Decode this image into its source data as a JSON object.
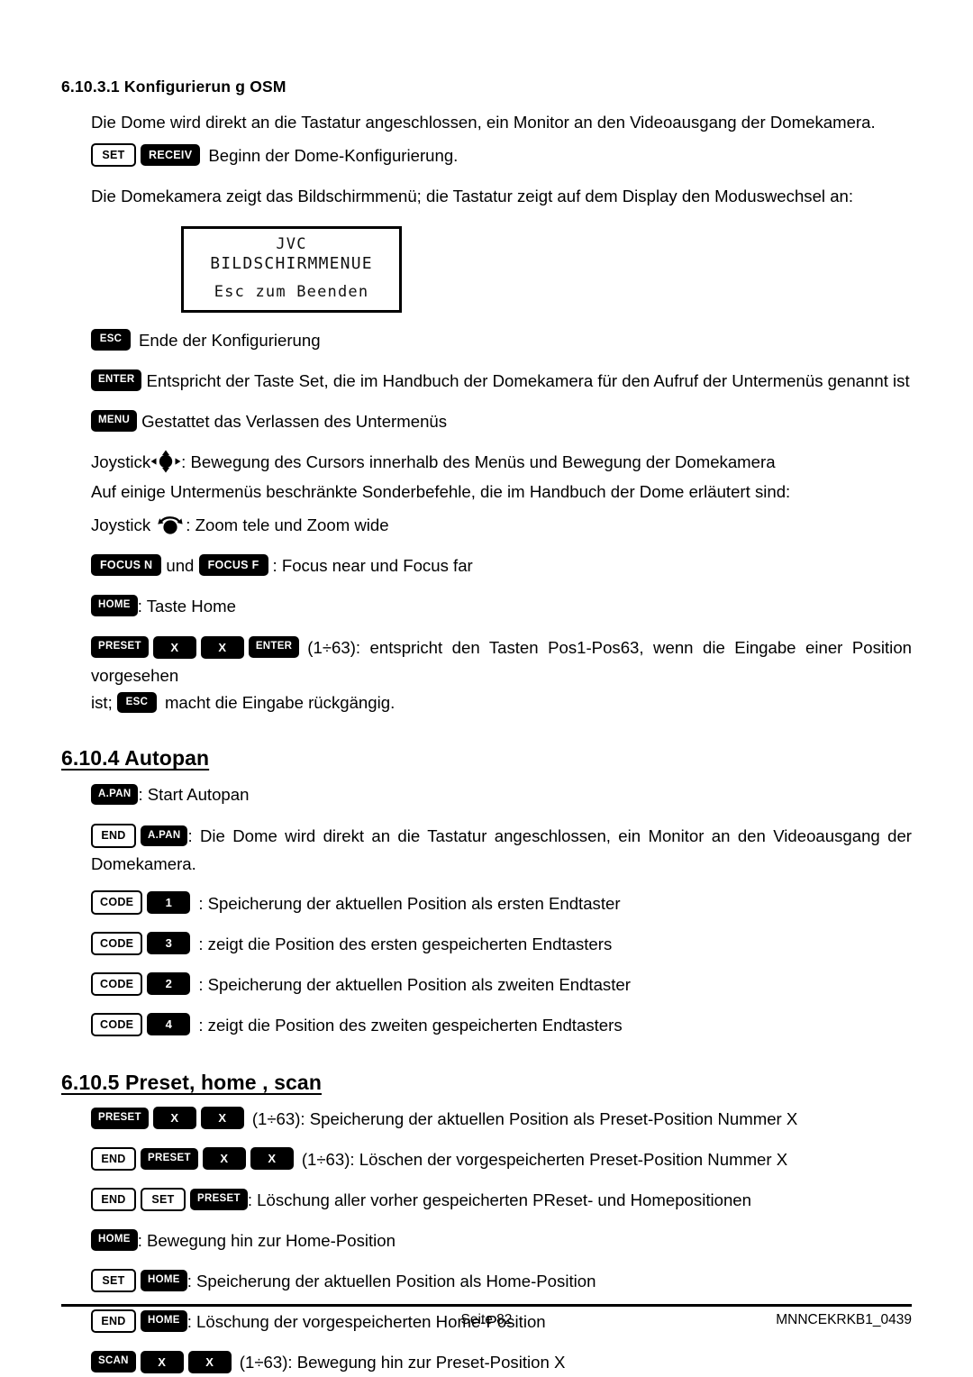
{
  "document": {
    "section_osm": {
      "heading": "6.10.3.1 Konfigurierun g OSM",
      "intro": "Die Dome wird direkt an die Tastatur angeschlossen, ein Monitor an den Videoausgang der Domekamera.",
      "set_receiv_text": "Beginn der Dome-Konfigurierung.",
      "osm_note": "Die Domekamera zeigt das Bildschirmmenü; die Tastatur zeigt auf dem Display den Moduswechsel an:",
      "esc_text": "Ende der Konfigurierung",
      "enter_text": "Entspricht der Taste Set, die im Handbuch der Domekamera für den Aufruf der Untermenüs genannt ist",
      "menu_text": "Gestattet das Verlassen des Untermenüs",
      "joystick_label": "Joystick",
      "joystick_move_text": ": Bewegung des Cursors innerhalb des Menüs und Bewegung der Domekamera",
      "special_note": "Auf einige Untermenüs beschränkte Sonderbefehle, die im Handbuch der Dome erläutert sind:",
      "joystick_zoom_text": ": Zoom tele und Zoom wide",
      "focus_conj": "und",
      "focus_text": ": Focus near und Focus far",
      "home_text": ": Taste Home",
      "preset_range": "(1÷63): entspricht den Tasten Pos1-Pos63, wenn die Eingabe einer Position vorgesehen",
      "preset_tail_prefix": "ist;",
      "preset_tail_suffix": "macht die Eingabe rückgängig."
    },
    "section_autopan": {
      "heading": "6.10.4 Autopan",
      "apan_text": ": Start Autopan",
      "end_apan_text": ": Die Dome wird direkt an die Tastatur angeschlossen, ein Monitor an den Videoausgang der Domekamera.",
      "code_rows": [
        {
          "code_label": "CODE",
          "num": "1",
          "text": ": Speicherung der aktuellen Position als ersten Endtaster"
        },
        {
          "code_label": "CODE",
          "num": "3",
          "text": ": zeigt die Position des ersten gespeicherten Endtasters"
        },
        {
          "code_label": "CODE",
          "num": "2",
          "text": ": Speicherung der aktuellen Position als zweiten Endtaster"
        },
        {
          "code_label": "CODE",
          "num": "4",
          "text": ": zeigt die Position des zweiten gespeicherten Endtasters"
        }
      ]
    },
    "section_preset": {
      "heading": "6.10.5 Preset, home , scan",
      "row_preset_xx": "(1÷63): Speicherung der aktuellen Position als Preset-Position Nummer X",
      "row_end_preset_xx": "(1÷63): Löschen der vorgespeicherten Preset-Position Nummer X",
      "row_end_set_preset": ": Löschung aller vorher gespeicherten PReset- und Homepositionen",
      "row_home": ": Bewegung hin zur Home-Position",
      "row_set_home": ": Speicherung der aktuellen Position als Home-Position",
      "row_end_home": ": Löschung der vorgespeicherten Home-Position",
      "row_scan_xx": "(1÷63): Bewegung hin zur Preset-Position X"
    }
  },
  "lcd": {
    "line1": "JVC",
    "line2": "BILDSCHIRMMENUE",
    "line3": "Esc zum Beenden"
  },
  "keys": {
    "set": "SET",
    "receiv": "RECEIV",
    "esc": "ESC",
    "enter": "ENTER",
    "menu": "MENU",
    "focus_n": "FOCUS N",
    "focus_f": "FOCUS F",
    "home": "HOME",
    "preset": "PRESET",
    "x": "X",
    "apan": "A.PAN",
    "end": "END",
    "code": "CODE",
    "scan": "SCAN"
  },
  "footer": {
    "page": "Seite 82",
    "doc_id": "MNNCEKRKB1_0439"
  }
}
